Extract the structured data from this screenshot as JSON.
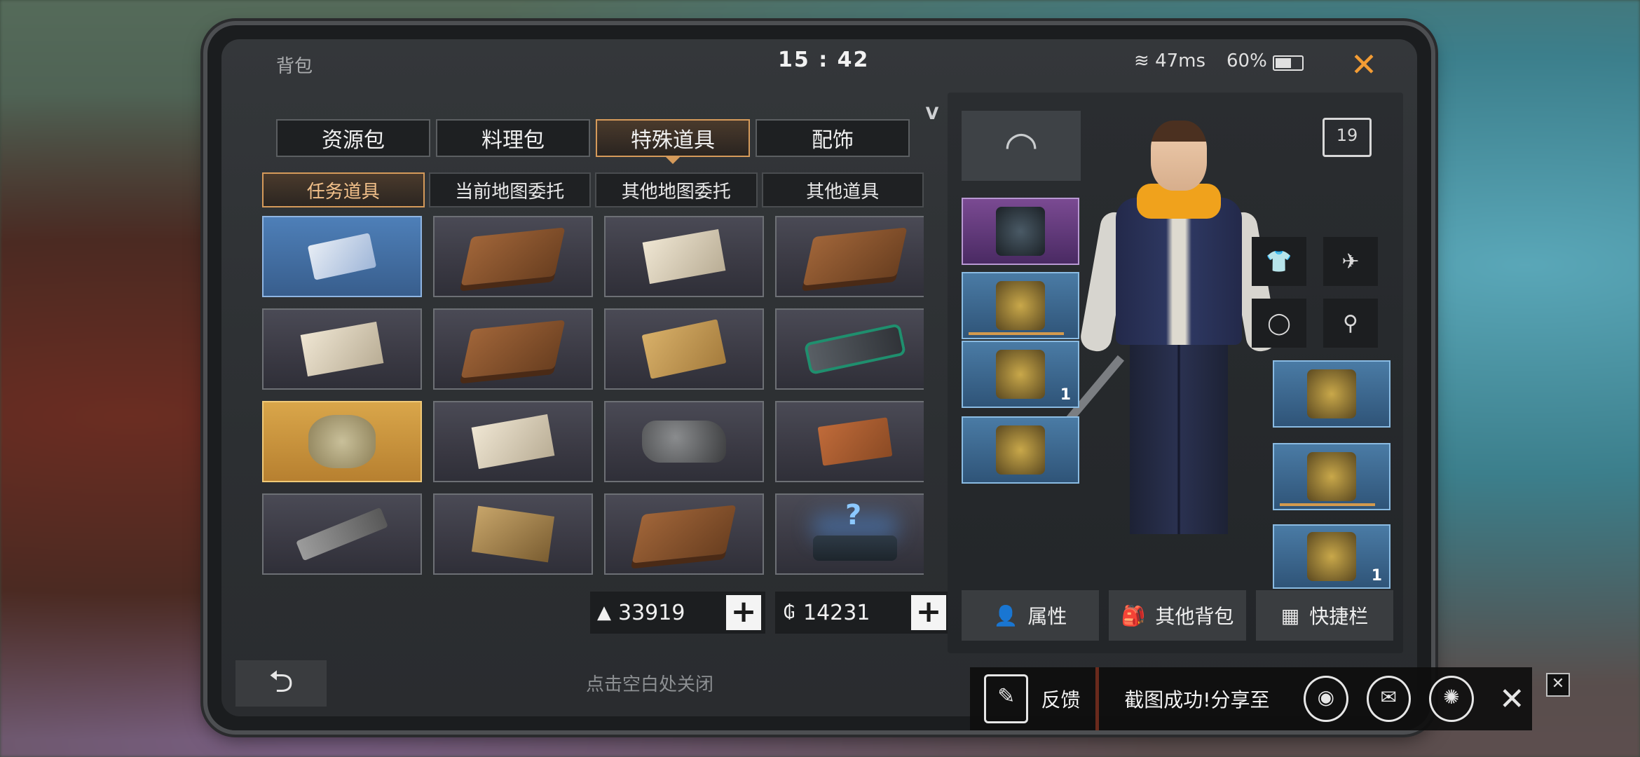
{
  "status": {
    "title": "背包",
    "time": "15 : 42",
    "latency": "47ms",
    "battery": "60%"
  },
  "tabs": [
    "资源包",
    "料理包",
    "特殊道具",
    "配饰"
  ],
  "subtabs": [
    "任务道具",
    "当前地图委托",
    "其他地图委托",
    "其他道具"
  ],
  "v_badge": "V",
  "items": [
    {
      "icon": "id-card-icon",
      "bg": "blue"
    },
    {
      "icon": "leather-book-icon",
      "bg": "dark"
    },
    {
      "icon": "wanted-poster-icon",
      "bg": "dark"
    },
    {
      "icon": "leather-book-icon",
      "bg": "dark"
    },
    {
      "icon": "documents-icon",
      "bg": "dark"
    },
    {
      "icon": "leather-book-icon",
      "bg": "dark"
    },
    {
      "icon": "envelope-icon",
      "bg": "dark"
    },
    {
      "icon": "device-icon",
      "bg": "dark"
    },
    {
      "icon": "crumpled-map-icon",
      "bg": "gold"
    },
    {
      "icon": "paper-note-icon",
      "bg": "dark"
    },
    {
      "icon": "rock-icon",
      "bg": "dark"
    },
    {
      "icon": "sealed-envelope-icon",
      "bg": "dark"
    },
    {
      "icon": "pistol-icon",
      "bg": "dark"
    },
    {
      "icon": "photos-icon",
      "bg": "dark"
    },
    {
      "icon": "leather-book-icon",
      "bg": "dark"
    },
    {
      "icon": "mystery-box-icon",
      "bg": "dark",
      "label": "?"
    }
  ],
  "currency": {
    "gold": "33919",
    "coin": "14231",
    "plus": "+",
    "gold_symbol": "▲",
    "coin_symbol": "₲"
  },
  "equipment": {
    "rank": "19",
    "weapon_level": "1",
    "accessory_level": "1"
  },
  "actions": [
    "属性",
    "其他背包",
    "快捷栏"
  ],
  "bottom": {
    "back": "⮌",
    "close_hint": "点击空白处关闭"
  },
  "share": {
    "feedback": "反馈",
    "message": "截图成功!分享至",
    "close": "✕"
  }
}
